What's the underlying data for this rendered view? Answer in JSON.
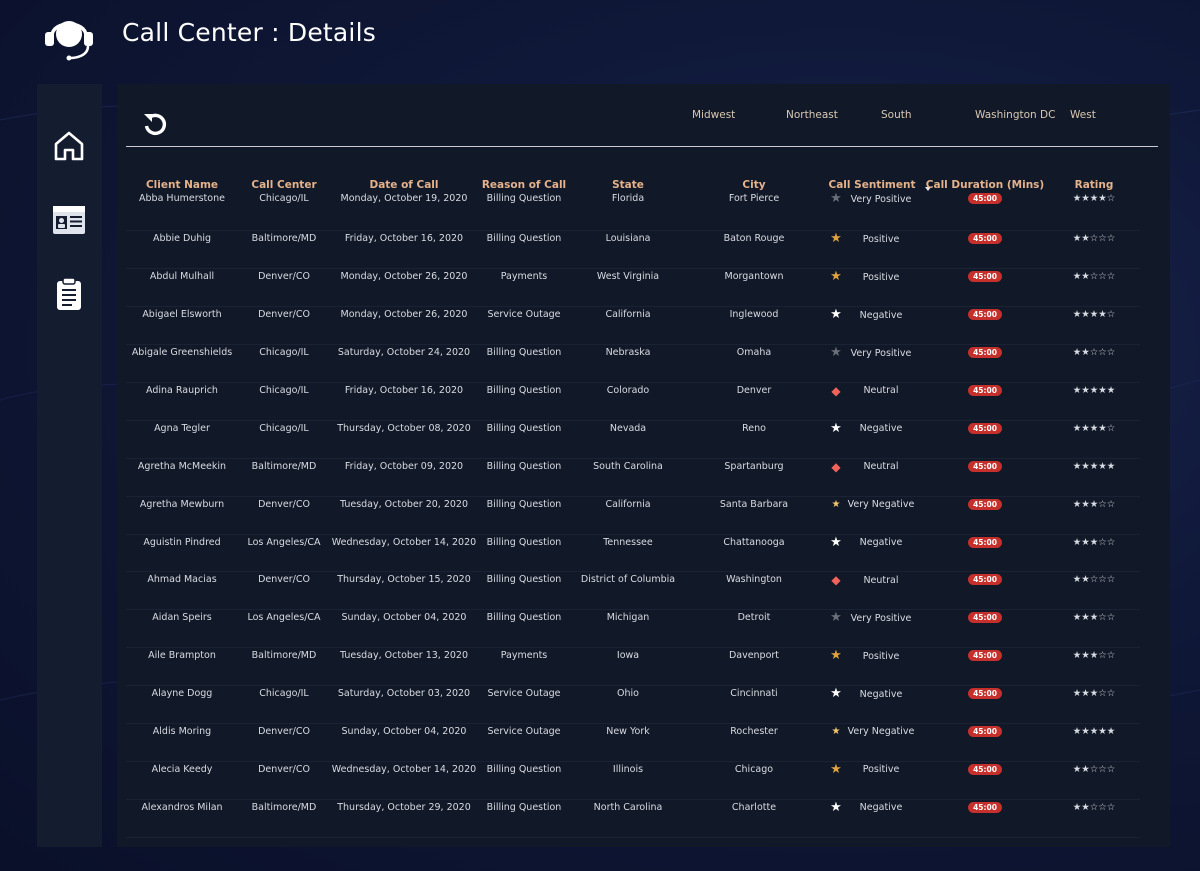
{
  "header": {
    "title": "Call Center : Details"
  },
  "sidebar": {
    "items": [
      {
        "icon": "home-icon"
      },
      {
        "icon": "id-card-icon"
      },
      {
        "icon": "clipboard-icon"
      }
    ]
  },
  "regions": [
    "Midwest",
    "Northeast",
    "South",
    "Washington DC",
    "West"
  ],
  "table": {
    "columns": [
      "Client Name",
      "Call Center",
      "Date of Call",
      "Reason of Call",
      "State",
      "City",
      "Call Sentiment",
      "Call Duration (Mins)",
      "Rating"
    ],
    "rows": [
      {
        "client": "Abba Humerstone",
        "center": "Chicago/IL",
        "date": "Monday, October 19, 2020",
        "reason": "Billing Question",
        "state": "Florida",
        "city": "Fort Pierce",
        "sentiment": "Very Positive",
        "duration": "45:00",
        "rating": "★★★★☆"
      },
      {
        "client": "Abbie Duhig",
        "center": "Baltimore/MD",
        "date": "Friday, October 16, 2020",
        "reason": "Billing Question",
        "state": "Louisiana",
        "city": "Baton Rouge",
        "sentiment": "Positive",
        "duration": "45:00",
        "rating": "★★☆☆☆"
      },
      {
        "client": "Abdul Mulhall",
        "center": "Denver/CO",
        "date": "Monday, October 26, 2020",
        "reason": "Payments",
        "state": "West Virginia",
        "city": "Morgantown",
        "sentiment": "Positive",
        "duration": "45:00",
        "rating": "★★☆☆☆"
      },
      {
        "client": "Abigael Elsworth",
        "center": "Denver/CO",
        "date": "Monday, October 26, 2020",
        "reason": "Service Outage",
        "state": "California",
        "city": "Inglewood",
        "sentiment": "Negative",
        "duration": "45:00",
        "rating": "★★★★☆"
      },
      {
        "client": "Abigale Greenshields",
        "center": "Chicago/IL",
        "date": "Saturday, October 24, 2020",
        "reason": "Billing Question",
        "state": "Nebraska",
        "city": "Omaha",
        "sentiment": "Very Positive",
        "duration": "45:00",
        "rating": "★★☆☆☆"
      },
      {
        "client": "Adina Rauprich",
        "center": "Chicago/IL",
        "date": "Friday, October 16, 2020",
        "reason": "Billing Question",
        "state": "Colorado",
        "city": "Denver",
        "sentiment": "Neutral",
        "duration": "45:00",
        "rating": "★★★★★"
      },
      {
        "client": "Agna Tegler",
        "center": "Chicago/IL",
        "date": "Thursday, October 08, 2020",
        "reason": "Billing Question",
        "state": "Nevada",
        "city": "Reno",
        "sentiment": "Negative",
        "duration": "45:00",
        "rating": "★★★★☆"
      },
      {
        "client": "Agretha McMeekin",
        "center": "Baltimore/MD",
        "date": "Friday, October 09, 2020",
        "reason": "Billing Question",
        "state": "South Carolina",
        "city": "Spartanburg",
        "sentiment": "Neutral",
        "duration": "45:00",
        "rating": "★★★★★"
      },
      {
        "client": "Agretha Mewburn",
        "center": "Denver/CO",
        "date": "Tuesday, October 20, 2020",
        "reason": "Billing Question",
        "state": "California",
        "city": "Santa Barbara",
        "sentiment": "Very Negative",
        "duration": "45:00",
        "rating": "★★★☆☆"
      },
      {
        "client": "Aguistin Pindred",
        "center": "Los Angeles/CA",
        "date": "Wednesday, October 14, 2020",
        "reason": "Billing Question",
        "state": "Tennessee",
        "city": "Chattanooga",
        "sentiment": "Negative",
        "duration": "45:00",
        "rating": "★★★☆☆"
      },
      {
        "client": "Ahmad Macias",
        "center": "Denver/CO",
        "date": "Thursday, October 15, 2020",
        "reason": "Billing Question",
        "state": "District of Columbia",
        "city": "Washington",
        "sentiment": "Neutral",
        "duration": "45:00",
        "rating": "★★☆☆☆"
      },
      {
        "client": "Aidan Speirs",
        "center": "Los Angeles/CA",
        "date": "Sunday, October 04, 2020",
        "reason": "Billing Question",
        "state": "Michigan",
        "city": "Detroit",
        "sentiment": "Very Positive",
        "duration": "45:00",
        "rating": "★★★☆☆"
      },
      {
        "client": "Aile Brampton",
        "center": "Baltimore/MD",
        "date": "Tuesday, October 13, 2020",
        "reason": "Payments",
        "state": "Iowa",
        "city": "Davenport",
        "sentiment": "Positive",
        "duration": "45:00",
        "rating": "★★★☆☆"
      },
      {
        "client": "Alayne Dogg",
        "center": "Chicago/IL",
        "date": "Saturday, October 03, 2020",
        "reason": "Service Outage",
        "state": "Ohio",
        "city": "Cincinnati",
        "sentiment": "Negative",
        "duration": "45:00",
        "rating": "★★★☆☆"
      },
      {
        "client": "Aldis Moring",
        "center": "Denver/CO",
        "date": "Sunday, October 04, 2020",
        "reason": "Service Outage",
        "state": "New York",
        "city": "Rochester",
        "sentiment": "Very Negative",
        "duration": "45:00",
        "rating": "★★★★★"
      },
      {
        "client": "Alecia Keedy",
        "center": "Denver/CO",
        "date": "Wednesday, October 14, 2020",
        "reason": "Billing Question",
        "state": "Illinois",
        "city": "Chicago",
        "sentiment": "Positive",
        "duration": "45:00",
        "rating": "★★☆☆☆"
      },
      {
        "client": "Alexandros Milan",
        "center": "Baltimore/MD",
        "date": "Thursday, October 29, 2020",
        "reason": "Billing Question",
        "state": "North Carolina",
        "city": "Charlotte",
        "sentiment": "Negative",
        "duration": "45:00",
        "rating": "★★☆☆☆"
      }
    ]
  },
  "sentiment_icons": {
    "Very Positive": {
      "glyph": "★",
      "color": "#6b6f7a",
      "icon": "star-grey-icon"
    },
    "Positive": {
      "glyph": "★",
      "color": "#e0a23c",
      "icon": "star-orange-icon"
    },
    "Negative": {
      "glyph": "★",
      "color": "#ffffff",
      "icon": "star-white-icon"
    },
    "Neutral": {
      "glyph": "◆",
      "color": "#f0625a",
      "icon": "diamond-red-icon"
    },
    "Very Negative": {
      "glyph": "★",
      "color": "#f2c46b",
      "icon": "star-small-icon"
    }
  },
  "colors": {
    "header_text": "#e4b28b",
    "badge": "#c5302c",
    "panel": "#111827",
    "sidebar": "#141c30"
  }
}
